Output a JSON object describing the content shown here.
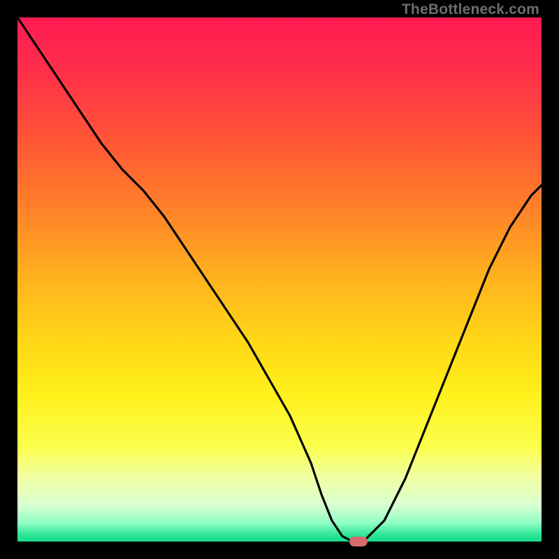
{
  "watermark": "TheBottleneck.com",
  "colors": {
    "gradient_stops": [
      {
        "offset": 0.0,
        "color": "#ff1b52"
      },
      {
        "offset": 0.1,
        "color": "#ff2e4a"
      },
      {
        "offset": 0.22,
        "color": "#ff5138"
      },
      {
        "offset": 0.35,
        "color": "#ff7c2a"
      },
      {
        "offset": 0.5,
        "color": "#ffb31e"
      },
      {
        "offset": 0.62,
        "color": "#ffd817"
      },
      {
        "offset": 0.72,
        "color": "#fff01a"
      },
      {
        "offset": 0.82,
        "color": "#fbff4f"
      },
      {
        "offset": 0.88,
        "color": "#f0ffa6"
      },
      {
        "offset": 0.93,
        "color": "#d9ffcf"
      },
      {
        "offset": 0.965,
        "color": "#8fffc4"
      },
      {
        "offset": 0.985,
        "color": "#36e79a"
      },
      {
        "offset": 1.0,
        "color": "#14da8a"
      }
    ],
    "curve": "#000000",
    "marker": "#d66a6f",
    "frame": "#000000"
  },
  "chart_data": {
    "type": "line",
    "title": "",
    "xlabel": "",
    "ylabel": "",
    "xlim": [
      0,
      100
    ],
    "ylim": [
      0,
      100
    ],
    "x": [
      0,
      4,
      8,
      12,
      16,
      20,
      24,
      28,
      32,
      36,
      40,
      44,
      48,
      52,
      56,
      58,
      60,
      62,
      64,
      66,
      70,
      74,
      78,
      82,
      86,
      90,
      94,
      98,
      100
    ],
    "values": [
      100,
      94,
      88,
      82,
      76,
      71,
      67,
      62,
      56,
      50,
      44,
      38,
      31,
      24,
      15,
      9,
      4,
      1,
      0,
      0,
      4,
      12,
      22,
      32,
      42,
      52,
      60,
      66,
      68
    ],
    "marker": {
      "x": 65,
      "y": 0
    },
    "notes": "y is bottleneck-like metric (higher = worse / red); green band near y=0; curve is V-shaped with minimum around x≈64–66"
  }
}
